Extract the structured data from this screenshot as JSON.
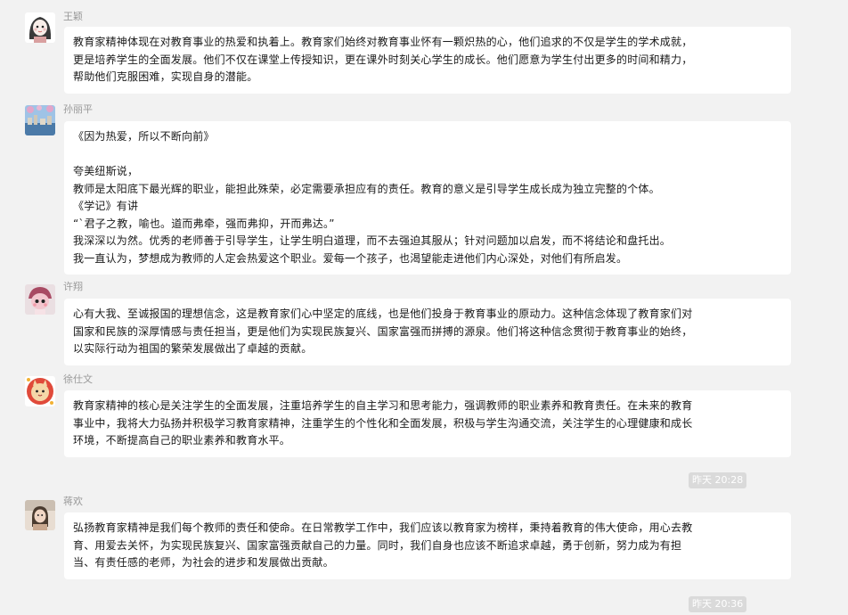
{
  "messages": [
    {
      "sender": "王颖",
      "lines": [
        "教育家精神体现在对教育事业的热爱和执着上。教育家们始终对教育事业怀有一颗炽热的心，他们追求的不仅是学生的学术成就，",
        "更是培养学生的全面发展。他们不仅在课堂上传授知识，更在课外时刻关心学生的成长。他们愿意为学生付出更多的时间和精力，",
        "帮助他们克服困难，实现自身的潜能。"
      ]
    },
    {
      "sender": "孙丽平",
      "lines": [
        "《因为热爱，所以不断向前》",
        "",
        "夸美纽斯说，",
        "教师是太阳底下最光辉的职业，能担此殊荣，必定需要承担应有的责任。教育的意义是引导学生成长成为独立完整的个体。",
        "《学记》有讲",
        "“`君子之教，喻也。道而弗牵，强而弗抑，开而弗达。”",
        "我深深以为然。优秀的老师善于引导学生，让学生明白道理，而不去强迫其服从；针对问题加以启发，而不将结论和盘托出。",
        "我一直认为，梦想成为教师的人定会热爱这个职业。爱每一个孩子，也渴望能走进他们内心深处，对他们有所启发。"
      ]
    },
    {
      "sender": "许翔",
      "lines": [
        "心有大我、至诚报国的理想信念，这是教育家们心中坚定的底线，也是他们投身于教育事业的原动力。这种信念体现了教育家们对",
        "国家和民族的深厚情感与责任担当，更是他们为实现民族复兴、国家富强而拼搏的源泉。他们将这种信念贯彻于教育事业的始终，",
        "以实际行动为祖国的繁荣发展做出了卓越的贡献。"
      ]
    },
    {
      "sender": "徐仕文",
      "lines": [
        "教育家精神的核心是关注学生的全面发展，注重培养学生的自主学习和思考能力，强调教师的职业素养和教育责任。在未来的教育",
        "事业中，我将大力弘扬并积极学习教育家精神，注重学生的个性化和全面发展，积极与学生沟通交流，关注学生的心理健康和成长",
        "环境，不断提高自己的职业素养和教育水平。"
      ]
    },
    {
      "sender": "蒋欢",
      "lines": [
        "弘扬教育家精神是我们每个教师的责任和使命。在日常教学工作中，我们应该以教育家为榜样，秉持着教育的伟大使命，用心去教",
        "育、用爱去关怀，为实现民族复兴、国家富强贡献自己的力量。同时，我们自身也应该不断追求卓越，勇于创新，努力成为有担",
        "当、有责任感的老师，为社会的进步和发展做出贡献。"
      ]
    }
  ],
  "timestamps": [
    "昨天 20:28",
    "昨天 20:36"
  ],
  "avatars": [
    {
      "icon": "cartoon-girl-avatar",
      "colors": [
        "#ffffff",
        "#3a3a3a",
        "#d9a0a0"
      ]
    },
    {
      "icon": "cityscape-avatar",
      "colors": [
        "#9fc3e6",
        "#e2a5c9",
        "#4b7aa8"
      ]
    },
    {
      "icon": "pink-doll-avatar",
      "colors": [
        "#f3c7cf",
        "#a84a63",
        "#eadfe2"
      ]
    },
    {
      "icon": "festive-cat-avatar",
      "colors": [
        "#e04a3a",
        "#f5d7a8",
        "#ffffff"
      ]
    },
    {
      "icon": "photo-portrait-avatar",
      "colors": [
        "#e8ddd2",
        "#4a3b2f",
        "#c9a88f"
      ]
    }
  ]
}
